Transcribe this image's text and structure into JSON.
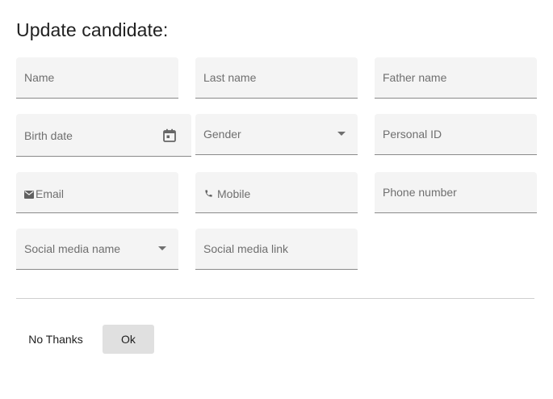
{
  "dialog": {
    "title": "Update candidate:"
  },
  "fields": {
    "name": {
      "placeholder": "Name"
    },
    "last_name": {
      "placeholder": "Last name"
    },
    "father_name": {
      "placeholder": "Father name"
    },
    "birth_date": {
      "placeholder": "Birth date",
      "icon": "calendar-icon"
    },
    "gender": {
      "placeholder": "Gender",
      "icon": "dropdown-arrow-icon"
    },
    "personal_id": {
      "placeholder": "Personal ID"
    },
    "email": {
      "placeholder": "Email",
      "icon": "envelope-icon"
    },
    "mobile": {
      "placeholder": "Mobile",
      "icon": "phone-icon"
    },
    "phone_number": {
      "placeholder": "Phone number"
    },
    "social_media_name": {
      "placeholder": "Social media name",
      "icon": "dropdown-arrow-icon"
    },
    "social_media_link": {
      "placeholder": "Social media link"
    }
  },
  "actions": {
    "no_thanks_label": "No Thanks",
    "ok_label": "Ok"
  },
  "colors": {
    "field_background": "#f4f4f4",
    "field_underline": "#8a8a8a",
    "placeholder_text": "#6f6f6f",
    "ok_button_background": "#e0e0e0"
  }
}
